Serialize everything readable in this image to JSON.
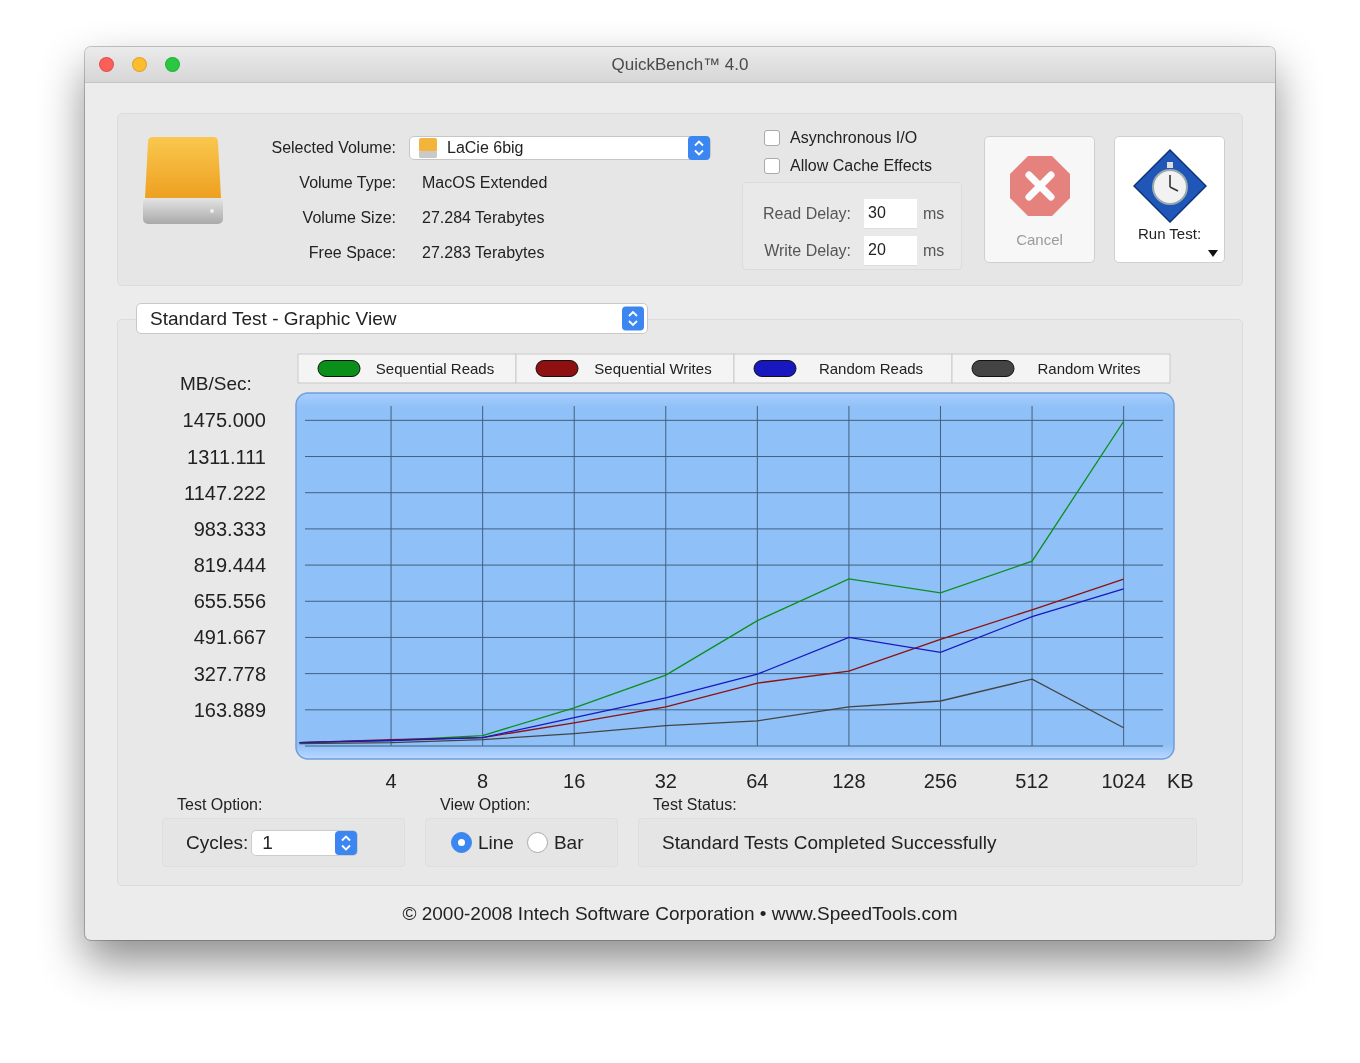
{
  "window": {
    "title": "QuickBench™ 4.0"
  },
  "volume": {
    "fields": [
      {
        "label": "Selected Volume:",
        "value": "LaCie 6big",
        "kind": "popup"
      },
      {
        "label": "Volume Type:",
        "value": "MacOS Extended",
        "kind": "text"
      },
      {
        "label": "Volume Size:",
        "value": "27.284 Terabytes",
        "kind": "text"
      },
      {
        "label": "Free Space:",
        "value": "27.283 Terabytes",
        "kind": "text"
      }
    ]
  },
  "options": {
    "checkboxes": [
      {
        "label": "Asynchronous I/O",
        "checked": false
      },
      {
        "label": "Allow Cache Effects",
        "checked": false
      }
    ],
    "delays": [
      {
        "label": "Read Delay:",
        "value": "30",
        "unit": "ms"
      },
      {
        "label": "Write Delay:",
        "value": "20",
        "unit": "ms"
      }
    ]
  },
  "buttons": [
    {
      "label": "Cancel",
      "kind": "cancel",
      "disabled": true
    },
    {
      "label": "Run Test:",
      "kind": "run",
      "disabled": false
    }
  ],
  "view_selector": {
    "value": "Standard Test - Graphic View"
  },
  "chart": {
    "chart_data": {
      "type": "line",
      "ylabel": "MB/Sec:",
      "xlabel": "KB",
      "categories": [
        null,
        "4",
        "8",
        "16",
        "32",
        "64",
        "128",
        "256",
        "512",
        "1024"
      ],
      "ylim": [
        0,
        1540
      ],
      "grid": true,
      "legend": true,
      "yticks": [
        {
          "value": 1475,
          "label": "1475.000"
        },
        {
          "value": 1311.111,
          "label": "1311.111"
        },
        {
          "value": 1147.222,
          "label": "1147.222"
        },
        {
          "value": 983.333,
          "label": "983.333"
        },
        {
          "value": 819.444,
          "label": "819.444"
        },
        {
          "value": 655.556,
          "label": "655.556"
        },
        {
          "value": 491.667,
          "label": "491.667"
        },
        {
          "value": 327.778,
          "label": "327.778"
        },
        {
          "value": 163.889,
          "label": "163.889"
        }
      ],
      "series": [
        {
          "name": "Sequential Reads",
          "color": "#0a8f1a",
          "values": [
            15,
            25,
            47,
            173,
            321,
            568,
            757,
            694,
            837,
            1470
          ]
        },
        {
          "name": "Sequential Writes",
          "color": "#8e1010",
          "values": [
            15,
            29,
            38,
            105,
            177,
            285,
            339,
            483,
            617,
            756
          ]
        },
        {
          "name": "Random Reads",
          "color": "#1818c0",
          "values": [
            15,
            25,
            38,
            128,
            218,
            325,
            492,
            424,
            586,
            712
          ]
        },
        {
          "name": "Random Writes",
          "color": "#444444",
          "values": [
            11,
            15,
            29,
            56,
            92,
            114,
            177,
            204,
            303,
            83
          ]
        }
      ]
    }
  },
  "test_option": {
    "heading": "Test Option:",
    "label": "Cycles:",
    "value": "1"
  },
  "view_option": {
    "heading": "View Option:",
    "options": [
      {
        "label": "Line",
        "selected": true
      },
      {
        "label": "Bar",
        "selected": false
      }
    ]
  },
  "test_status": {
    "heading": "Test Status:",
    "message": "Standard Tests Completed Successfully"
  },
  "footer": "© 2000-2008 Intech Software Corporation • www.SpeedTools.com"
}
